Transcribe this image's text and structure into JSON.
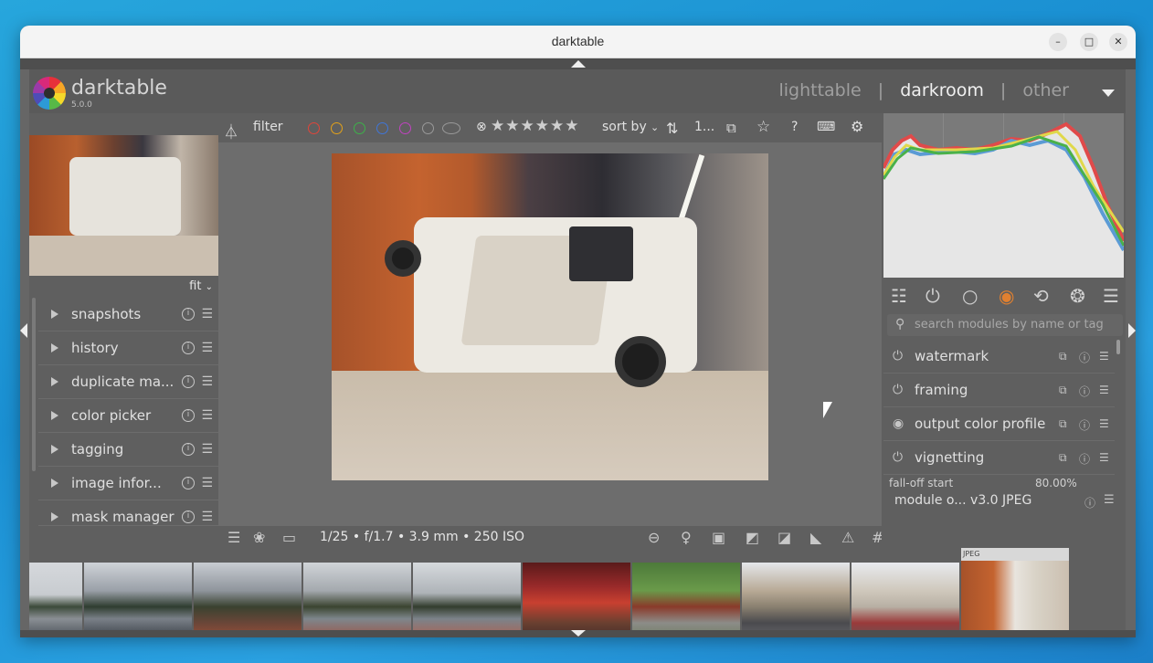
{
  "window": {
    "title": "darktable",
    "min_icon": "minimize-icon",
    "max_icon": "maximize-icon",
    "close_icon": "close-icon"
  },
  "header": {
    "app_name": "darktable",
    "version": "5.0.0",
    "views": [
      "lighttable",
      "darkroom",
      "other"
    ],
    "active_view": "darkroom",
    "separator": "|"
  },
  "left": {
    "zoom": "fit",
    "modules": [
      {
        "label": "snapshots"
      },
      {
        "label": "history"
      },
      {
        "label": "duplicate ma..."
      },
      {
        "label": "color picker"
      },
      {
        "label": "tagging"
      },
      {
        "label": "image infor..."
      },
      {
        "label": "mask manager"
      }
    ]
  },
  "toolbar": {
    "filter": "filter",
    "sort_by": "sort by",
    "count": "1...",
    "icons": [
      "filter-icon",
      "reject-icon",
      "star-rating-icon",
      "sort-order-icon",
      "grouping-icon",
      "star-icon",
      "help-icon",
      "keyboard-icon",
      "settings-icon"
    ],
    "color_labels": [
      "#e0453a",
      "#e3a21a",
      "#3db24a",
      "#3f76d8",
      "#c043c0",
      "#9a9a9a"
    ]
  },
  "center": {
    "exif": "1/25 • f/1.7 • 3.9 mm • 250 ISO"
  },
  "right": {
    "search_placeholder": "search modules by name or tag",
    "module_groups_icons": [
      "sliders-icon",
      "power-icon",
      "circle-icon",
      "color-wheel-icon",
      "refresh-icon",
      "aperture-icon",
      "menu-icon"
    ],
    "modules": [
      {
        "label": "watermark",
        "power": "power-icon"
      },
      {
        "label": "framing",
        "power": "power-icon"
      },
      {
        "label": "output color profile",
        "power": "radio-icon"
      },
      {
        "label": "vignetting",
        "power": "power-icon"
      }
    ],
    "partial_row": {
      "label": "fall-off start",
      "value": "80.00%"
    },
    "bottom": "module o... v3.0 JPEG"
  },
  "filmstrip": {
    "last_label": "JPEG",
    "rating": "★★★★☆"
  }
}
